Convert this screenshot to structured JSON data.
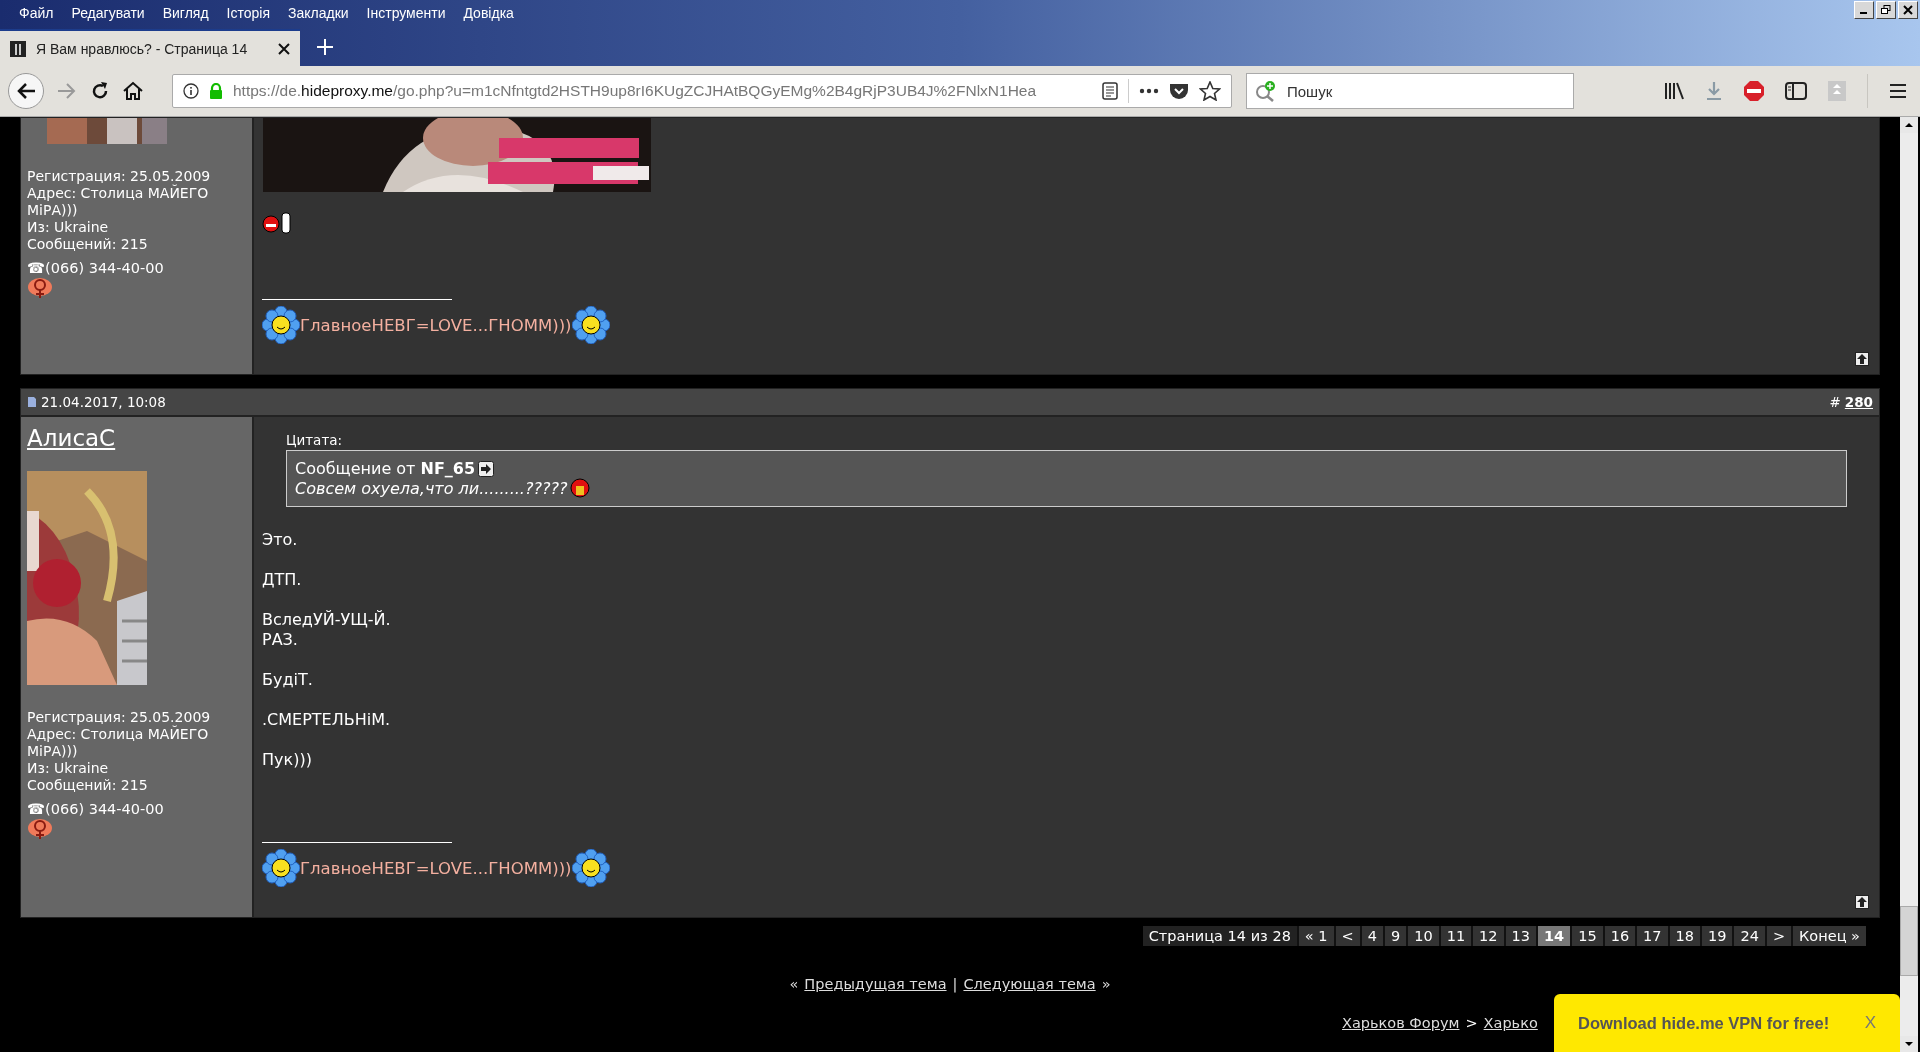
{
  "browser": {
    "menu": [
      "Файл",
      "Редагувати",
      "Вигляд",
      "Історія",
      "Закладки",
      "Інструменти",
      "Довідка"
    ],
    "tab": {
      "title": "Я Вам нравлюсь? - Страница 14",
      "selected": true
    },
    "address": {
      "prefix": "https://de.",
      "host": "hideproxy.me",
      "path": "/go.php?u=m1cNfntgtd2HSTH9up8rI6KUgZCJHAtBQGyEMg%2B4gRjP3UB4J%2FNlxN1Hea"
    },
    "search": {
      "placeholder": "Пошук"
    }
  },
  "posts": [
    {
      "partial": true,
      "user": {
        "details": [
          "Регистрация: 25.05.2009",
          "Адрес: Столица МАЙЕГО МiРА)))",
          "Из: Ukraine",
          "Сообщений: 215"
        ],
        "phone": "☎(066) 344-40-00"
      },
      "content": {
        "picture": true,
        "emoticons": true,
        "signature": "ГлавноеНЕВГ=LOVE...ГНОММ)))"
      }
    },
    {
      "partial": false,
      "date": "21.04.2017, 10:08",
      "number_prefix": "#",
      "number": "280",
      "user": {
        "name": "АлисаС",
        "details": [
          "Регистрация: 25.05.2009",
          "Адрес: Столица МАЙЕГО МiРА)))",
          "Из: Ukraine",
          "Сообщений: 215"
        ],
        "phone": "☎(066) 344-40-00"
      },
      "content": {
        "quote": {
          "label": "Цитата:",
          "author": "Сообщение от **NF_65**",
          "text": "Совсем охуела,что ли.........?????"
        },
        "paragraphs": [
          [
            "Это."
          ],
          [
            "ДТП."
          ],
          [
            "ВследУЙ-УЩ-Й.",
            "РАЗ."
          ],
          [
            "БудiТ."
          ],
          [
            ".СМЕРТЕЛЬНiМ."
          ],
          [
            "Пук)))"
          ]
        ],
        "signature": "ГлавноеНЕВГ=LOVE...ГНОММ)))"
      }
    }
  ],
  "pagination": {
    "label": "Страница 14 из 28",
    "pages": [
      {
        "text": "« 1",
        "selected": false
      },
      {
        "text": "<",
        "selected": false
      },
      {
        "text": "4",
        "selected": false
      },
      {
        "text": "9",
        "selected": false
      },
      {
        "text": "10",
        "selected": false
      },
      {
        "text": "11",
        "selected": false
      },
      {
        "text": "12",
        "selected": false
      },
      {
        "text": "13",
        "selected": false
      },
      {
        "text": "14",
        "selected": true
      },
      {
        "text": "15",
        "selected": false
      },
      {
        "text": "16",
        "selected": false
      },
      {
        "text": "17",
        "selected": false
      },
      {
        "text": "18",
        "selected": false
      },
      {
        "text": "19",
        "selected": false
      },
      {
        "text": "24",
        "selected": false
      },
      {
        "text": ">",
        "selected": false
      },
      {
        "text": "Конец »",
        "selected": false
      }
    ]
  },
  "thread_nav": {
    "prev_mark": "«",
    "prev": "Предыдущая тема",
    "separator": "|",
    "next": "Следующая тема",
    "next_mark": "»"
  },
  "breadcrumb": [
    {
      "text": "Харьков Форум"
    },
    {
      "text": ">"
    },
    {
      "text": "Харько"
    }
  ],
  "popup": {
    "text": "Download hide.me VPN for free!",
    "close": "X"
  }
}
